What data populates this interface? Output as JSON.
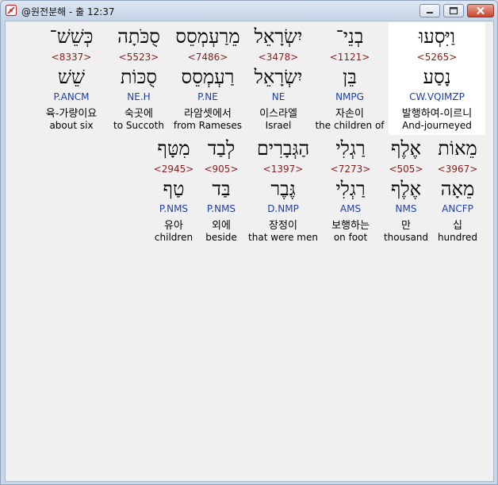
{
  "window": {
    "title": "@원전분해 - 출 12:37"
  },
  "rows": [
    {
      "words": [
        {
          "hebrew": "כְּשֵׁשׁ־",
          "strong": "<8337>",
          "lemma": "שֵׁשׁ",
          "parse": "P.ANCM",
          "korean": "육-가량이요",
          "gloss": "about six"
        },
        {
          "hebrew": "סֻכֹּתָה",
          "strong": "<5523>",
          "lemma": "סֻכּוֹת",
          "parse": "NE.H",
          "korean": "숙곳에",
          "gloss": "to Succoth"
        },
        {
          "hebrew": "מֵרַעְמְסֵס",
          "strong": "<7486>",
          "lemma": "רַעְמְסֵס",
          "parse": "P.NE",
          "korean": "라암셋에서",
          "gloss": "from Rameses"
        },
        {
          "hebrew": "יִשְׂרָאֵל",
          "strong": "<3478>",
          "lemma": "יִשְׂרָאֵל",
          "parse": "NE",
          "korean": "이스라엘",
          "gloss": "Israel"
        },
        {
          "hebrew": "בְנֵי־",
          "strong": "<1121>",
          "lemma": "בֵּן",
          "parse": "NMPG",
          "korean": "자손이",
          "gloss": "the children of"
        },
        {
          "hebrew": "וַיִּסְעוּ",
          "strong": "<5265>",
          "lemma": "נָסַע",
          "parse": "CW.VQIMZP",
          "korean": "발행하여-이르니",
          "gloss": "And-journeyed"
        }
      ]
    },
    {
      "words": [
        {
          "hebrew": "מִטָּף",
          "strong": "<2945>",
          "lemma": "טַף",
          "parse": "P.NMS",
          "korean": "유아",
          "gloss": "children"
        },
        {
          "hebrew": "לְבַד",
          "strong": "<905>",
          "lemma": "בַּד",
          "parse": "P.NMS",
          "korean": "외에",
          "gloss": "beside"
        },
        {
          "hebrew": "הַגְּבָרִים",
          "strong": "<1397>",
          "lemma": "גֶּבֶר",
          "parse": "D.NMP",
          "korean": "장정이",
          "gloss": "that were men"
        },
        {
          "hebrew": "רַגְלִי",
          "strong": "<7273>",
          "lemma": "רַגְלִי",
          "parse": "AMS",
          "korean": "보행하는",
          "gloss": "on foot"
        },
        {
          "hebrew": "אֶלֶף",
          "strong": "<505>",
          "lemma": "אֶלֶף",
          "parse": "NMS",
          "korean": "만",
          "gloss": "thousand"
        },
        {
          "hebrew": "מֵאוֹת",
          "strong": "<3967>",
          "lemma": "מֵאָה",
          "parse": "ANCFP",
          "korean": "십",
          "gloss": "hundred"
        }
      ]
    }
  ],
  "colors": {
    "strong": "#8b1c1c",
    "parse": "#1f3fa8",
    "highlight": "#ffffff"
  },
  "icons": {
    "app": "document-compass-icon",
    "minimize": "minimize-icon",
    "maximize": "maximize-icon",
    "close": "close-icon"
  }
}
